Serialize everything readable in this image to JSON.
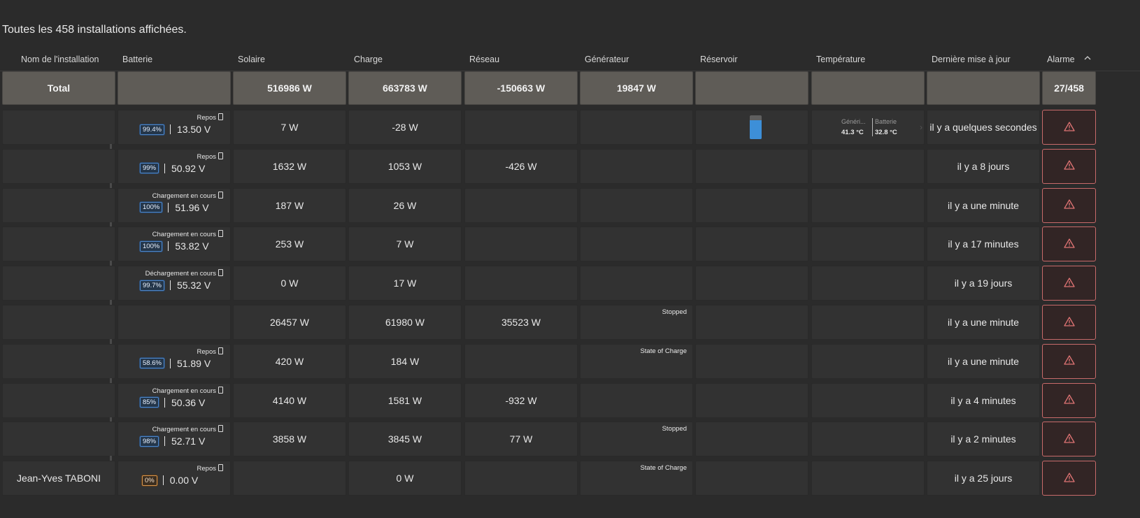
{
  "summary": "Toutes les 458 installations affichées.",
  "columns": {
    "name": "Nom de l'installation",
    "battery": "Batterie",
    "solar": "Solaire",
    "load": "Charge",
    "grid": "Réseau",
    "generator": "Générateur",
    "tank": "Réservoir",
    "temperature": "Température",
    "updated": "Dernière mise à jour",
    "alarm": "Alarme",
    "sort_icon": "chevron-up-icon"
  },
  "total": {
    "label": "Total",
    "solar": "516986 W",
    "load": "663783 W",
    "grid": "-150663 W",
    "generator": "19847 W",
    "alarm": "27/458"
  },
  "rows": [
    {
      "name": "",
      "status": "Repos",
      "soc": "99.4%",
      "voltage": "13.50 V",
      "solar": "7 W",
      "load": "-28 W",
      "grid": "",
      "generator": "",
      "updated": "il y a quelques secondes",
      "tank_level": 0.8,
      "temp": {
        "label1": "Généri...",
        "value1": "41.3 °C",
        "label2": "Batterie",
        "value2": "32.8 °C"
      }
    },
    {
      "name": "",
      "status": "Repos",
      "soc": "99%",
      "voltage": "50.92 V",
      "solar": "1632 W",
      "load": "1053 W",
      "grid": "-426 W",
      "generator": "",
      "updated": "il y a 8 jours"
    },
    {
      "name": "",
      "status": "Chargement en cours",
      "soc": "100%",
      "voltage": "51.96 V",
      "solar": "187 W",
      "load": "26 W",
      "grid": "",
      "generator": "",
      "updated": "il y a une minute"
    },
    {
      "name": "",
      "status": "Chargement en cours",
      "soc": "100%",
      "voltage": "53.82 V",
      "solar": "253 W",
      "load": "7 W",
      "grid": "",
      "generator": "",
      "updated": "il y a 17 minutes"
    },
    {
      "name": "",
      "status": "Déchargement en cours",
      "soc": "99.7%",
      "voltage": "55.32 V",
      "solar": "0 W",
      "load": "17 W",
      "grid": "",
      "generator": "",
      "updated": "il y a 19 jours"
    },
    {
      "name": "",
      "status": "",
      "soc": "",
      "voltage": "",
      "solar": "26457 W",
      "load": "61980 W",
      "grid": "35523 W",
      "generator": "Stopped",
      "updated": "il y a une minute"
    },
    {
      "name": "",
      "status": "Repos",
      "soc": "58.6%",
      "voltage": "51.89 V",
      "solar": "420 W",
      "load": "184 W",
      "grid": "",
      "generator": "State of Charge",
      "updated": "il y a une minute"
    },
    {
      "name": "",
      "status": "Chargement en cours",
      "soc": "85%",
      "voltage": "50.36 V",
      "solar": "4140 W",
      "load": "1581 W",
      "grid": "-932 W",
      "generator": "",
      "updated": "il y a 4 minutes"
    },
    {
      "name": "",
      "status": "Chargement en cours",
      "soc": "98%",
      "voltage": "52.71 V",
      "solar": "3858 W",
      "load": "3845 W",
      "grid": "77 W",
      "generator": "Stopped",
      "updated": "il y a 2 minutes"
    },
    {
      "name": "Jean-Yves TABONI",
      "status": "Repos",
      "soc": "0%",
      "soc_low": true,
      "voltage": "0.00 V",
      "solar": "",
      "load": "0 W",
      "grid": "",
      "generator": "State of Charge",
      "updated": "il y a 25 jours"
    }
  ],
  "colors": {
    "alarm": "#c86a6a",
    "tank_fill": "#3d8fd8",
    "soc_border": "#4f85c6"
  },
  "icons": {
    "battery": "battery-icon",
    "alarm": "warning-triangle-icon",
    "chevron": "chevron-right-icon"
  }
}
